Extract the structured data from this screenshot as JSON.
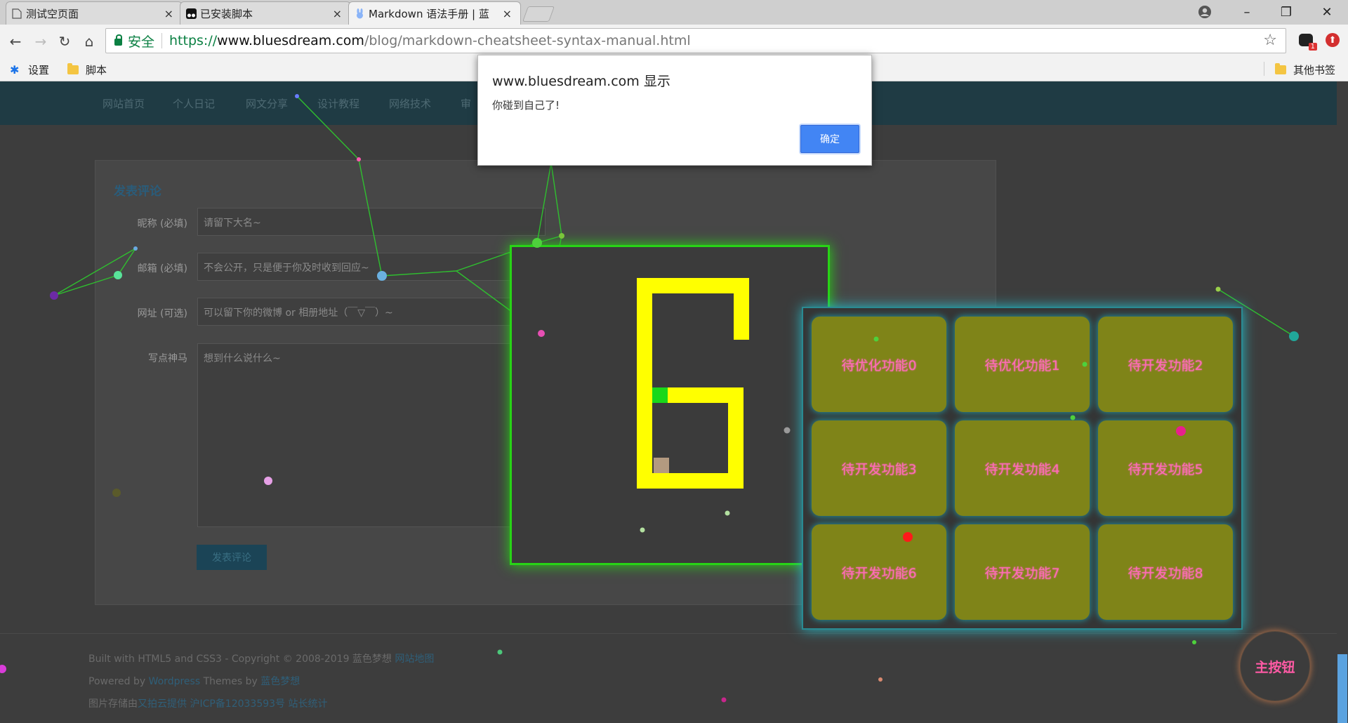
{
  "browser": {
    "tabs": [
      {
        "title": "测试空页面",
        "close": "×"
      },
      {
        "title": "已安装脚本",
        "close": "×"
      },
      {
        "title": "Markdown 语法手册 | 蓝",
        "close": "×"
      }
    ],
    "window_controls": {
      "minimize": "–",
      "restore": "❐",
      "close": "✕"
    },
    "nav": {
      "back": "←",
      "forward": "→",
      "reload": "↻",
      "home": "⌂"
    },
    "secure_label": "安全",
    "url": {
      "scheme": "https://",
      "host": "www.bluesdream.com",
      "path": "/blog/markdown-cheatsheet-syntax-manual.html"
    },
    "star_icon": "☆",
    "extension_badge": "1",
    "bookmarks": [
      {
        "label": "设置",
        "icon": "gear-icon"
      },
      {
        "label": "脚本",
        "icon": "folder-icon"
      }
    ],
    "other_bookmarks": "其他书签"
  },
  "site": {
    "nav_items": [
      "网站首页",
      "个人日记",
      "网文分享",
      "设计教程",
      "网络技术",
      "审"
    ],
    "comment": {
      "title": "发表评论",
      "fields": [
        {
          "label": "昵称 (必填)",
          "placeholder": "请留下大名~"
        },
        {
          "label": "邮箱 (必填)",
          "placeholder": "不会公开，只是便于你及时收到回应~"
        },
        {
          "label": "网址 (可选)",
          "placeholder": "可以留下你的微博 or 相册地址（￣▽￣）~"
        }
      ],
      "textarea_label": "写点神马",
      "textarea_placeholder": "想到什么说什么~",
      "submit": "发表评论"
    },
    "footer": {
      "line1_text": "Built with HTML5 and CSS3 - Copyright © 2008-2019 蓝色梦想 ",
      "line1_link": "网站地图",
      "line2_text_a": "Powered by ",
      "line2_link_a": "Wordpress",
      "line2_text_b": " Themes by ",
      "line2_link_b": "蓝色梦想",
      "line3_text": "图片存储由",
      "line3_link_a": "又拍云提供",
      "line3_link_b": " 沪ICP备12033593号",
      "line3_link_c": " 站长统计"
    }
  },
  "overlay_ui": {
    "game_digit": "6",
    "function_buttons": [
      "待优化功能0",
      "待优化功能1",
      "待开发功能2",
      "待开发功能3",
      "待开发功能4",
      "待开发功能5",
      "待开发功能6",
      "待开发功能7",
      "待开发功能8"
    ],
    "main_button": "主按钮",
    "colors": {
      "game_border": "#28d416",
      "digit": "#ffff00",
      "grid_glow": "#27b7c4",
      "button_bg": "#7f8418",
      "button_text": "#ff6bb8"
    }
  },
  "dialog": {
    "title": "www.bluesdream.com 显示",
    "message": "你碰到自己了!",
    "ok": "确定"
  }
}
